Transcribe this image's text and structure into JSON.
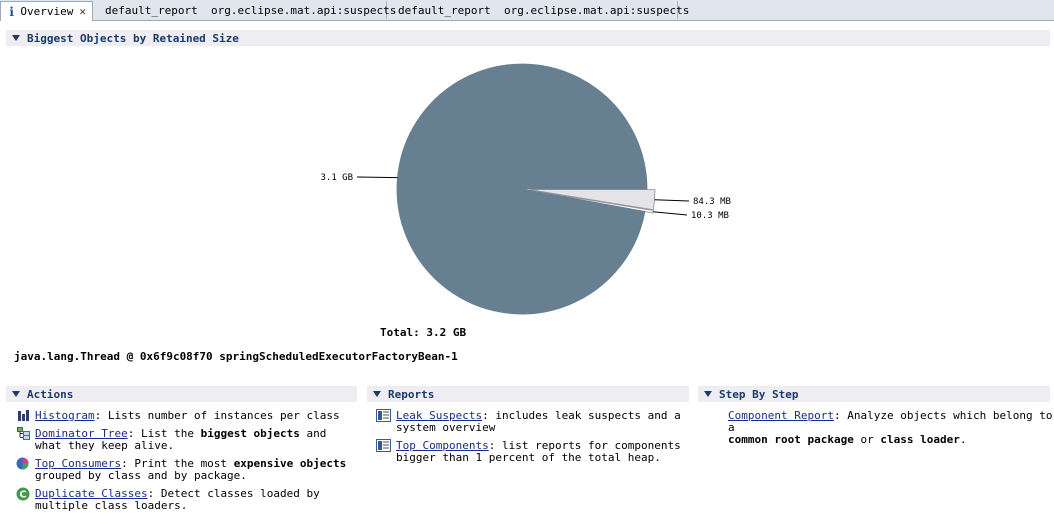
{
  "tabs": [
    {
      "label": "Overview",
      "icon": "info-icon",
      "closable": true
    },
    {
      "label": "default_report  org.eclipse.mat.api:suspects",
      "icon": "report-icon"
    },
    {
      "label": "default_report  org.eclipse.mat.api:suspects",
      "icon": "report-icon"
    }
  ],
  "biggest": {
    "title": "Biggest Objects by Retained Size",
    "total_label": "Total: 3.2 GB",
    "thread_label": "java.lang.Thread @ 0x6f9c08f70 springScheduledExecutorFactoryBean-1"
  },
  "chart_data": {
    "type": "pie",
    "slices": [
      {
        "label": "3.1 GB",
        "value": 3174.4,
        "color": "#667f91"
      },
      {
        "label": "84.3 MB",
        "value": 84.3,
        "color": "#e4e4e6"
      },
      {
        "label": "10.3 MB",
        "value": 10.3,
        "color": "#ffffff"
      }
    ]
  },
  "actions": {
    "title": "Actions",
    "items": [
      {
        "link": "Histogram",
        "l1": ": Lists number of instances per class",
        "l2": ""
      },
      {
        "link": "Dominator Tree",
        "pre": ": List the ",
        "bold1": "biggest objects",
        "post": " and",
        "l2": "what they keep alive."
      },
      {
        "link": "Top Consumers",
        "pre": ": Print the most ",
        "bold1": "expensive objects",
        "post": "",
        "l2": "grouped by class and by package."
      },
      {
        "link": "Duplicate Classes",
        "l1": ": Detect classes loaded by",
        "l2": "multiple class loaders."
      }
    ]
  },
  "reports": {
    "title": "Reports",
    "items": [
      {
        "link": "Leak Suspects",
        "l1": ": includes leak suspects and a",
        "l2": "system overview"
      },
      {
        "link": "Top Components",
        "l1": ": list reports for components",
        "l2": "bigger than 1 percent of the total heap."
      }
    ]
  },
  "step": {
    "title": "Step By Step",
    "link": "Component Report",
    "l1": ": Analyze objects which belong to a",
    "bold1": "common root package",
    "mid": " or ",
    "bold2": "class loader",
    "end": "."
  }
}
